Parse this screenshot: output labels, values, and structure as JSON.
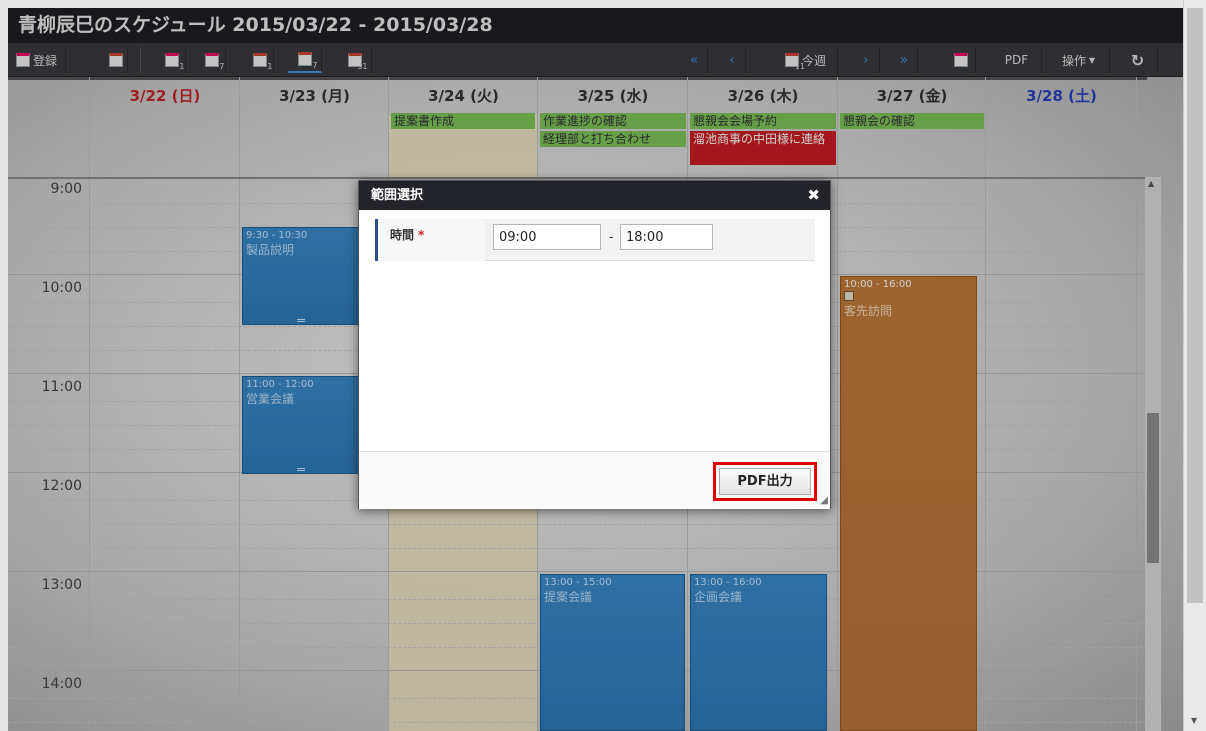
{
  "window": {
    "title": "青柳辰巳のスケジュール 2015/03/22 - 2015/03/28"
  },
  "toolbar": {
    "register_label": "登録",
    "today_label": "今週",
    "pdf_label": "PDF",
    "operations_label": "操作",
    "operations_caret": "▾",
    "refresh_icon": "↻",
    "day1_num": "1",
    "day7_num": "7",
    "week1_num": "1",
    "week7_num": "7",
    "month_num": "31",
    "first_icon": "«",
    "prev_icon": "‹",
    "next_icon": "›",
    "last_icon": "»",
    "cal_num": "11"
  },
  "days": [
    {
      "label": "3/22 (日)",
      "color": "#c0262d"
    },
    {
      "label": "3/23 (月)",
      "color": "#333333"
    },
    {
      "label": "3/24 (火)",
      "color": "#333333"
    },
    {
      "label": "3/25 (水)",
      "color": "#333333"
    },
    {
      "label": "3/26 (木)",
      "color": "#333333"
    },
    {
      "label": "3/27 (金)",
      "color": "#333333"
    },
    {
      "label": "3/28 (土)",
      "color": "#2a3fbf"
    }
  ],
  "allday": {
    "tue_1": "提案書作成",
    "wed_1": "作業進捗の確認",
    "wed_2": "経理部と打ち合わせ",
    "thu_1": "懇親会会場予約",
    "thu_2": "溜池商事の中田様に連絡",
    "fri_1": "懇親会の確認"
  },
  "times": [
    "9:00",
    "10:00",
    "11:00",
    "12:00",
    "13:00",
    "14:00"
  ],
  "events": {
    "e1": {
      "time": "9:30 - 10:30",
      "name": "製品説明"
    },
    "e2": {
      "time": "11:00 - 12:00",
      "name": "営業会議"
    },
    "e3": {
      "time": "13:00 - 15:00",
      "name": "提案会議"
    },
    "e4": {
      "time": "13:00 - 16:00",
      "name": "企画会議"
    },
    "e5": {
      "time": "10:00 - 16:00",
      "name": "客先訪問"
    }
  },
  "dialog": {
    "title": "範囲選択",
    "close_icon": "✖",
    "field_label": "時間",
    "required_mark": "*",
    "start_value": "09:00",
    "separator": "-",
    "end_value": "18:00",
    "submit_label": "PDF出力"
  },
  "colors": {
    "accent_red": "#e00000",
    "event_blue": "#2d79b8",
    "event_orange": "#b7743a",
    "allday_green": "#7ec35a",
    "allday_red": "#c81e24"
  }
}
